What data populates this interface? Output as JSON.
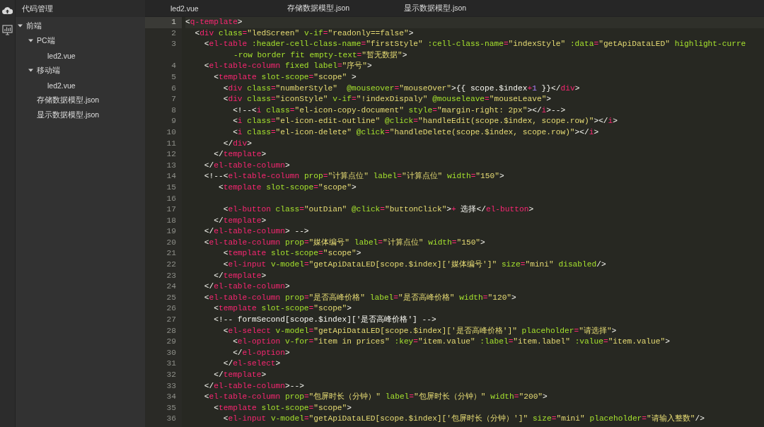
{
  "sidebar": {
    "title": "代码管理",
    "tree": [
      {
        "label": "前端",
        "expanded": true,
        "children": [
          {
            "label": "PC端",
            "expanded": true,
            "children": [
              {
                "label": "led2.vue"
              }
            ]
          },
          {
            "label": "移动端",
            "expanded": true,
            "children": [
              {
                "label": "led2.vue"
              }
            ]
          },
          {
            "label": "存储数据模型.json"
          },
          {
            "label": "显示数据模型.json"
          }
        ]
      }
    ]
  },
  "tabs": [
    {
      "label": "led2.vue"
    },
    {
      "label": "存储数据模型.json"
    },
    {
      "label": "显示数据模型.json"
    }
  ],
  "editor": {
    "lines": [
      {
        "n": "1",
        "current": true,
        "text": "<q-template>"
      },
      {
        "n": "2",
        "current": false,
        "text": "  <div class=\"ledScreen\" v-if=\"readonly==false\">"
      },
      {
        "n": "3",
        "current": false,
        "text": "    <el-table :header-cell-class-name=\"firstStyle\" :cell-class-name=\"indexStyle\" :data=\"getApiDataLED\" highlight-curre",
        "wrap": "-row border fit empty-text=\"暂无数据\">"
      },
      {
        "n": "4",
        "current": false,
        "text": "    <el-table-column fixed label=\"序号\">"
      },
      {
        "n": "5",
        "current": false,
        "text": "      <template slot-scope=\"scope\" >"
      },
      {
        "n": "6",
        "current": false,
        "text": "        <div class=\"numberStyle\"  @mouseover=\"mouseOver\">{{ scope.$index+1 }}</div>"
      },
      {
        "n": "7",
        "current": false,
        "text": "        <div class=\"iconStyle\" v-if=\"!indexDispaly\" @mouseleave=\"mouseLeave\">"
      },
      {
        "n": "8",
        "current": false,
        "text": "          <!--<i class=\"el-icon-copy-document\" style=\"margin-right: 2px\"></i>-->"
      },
      {
        "n": "9",
        "current": false,
        "text": "          <i class=\"el-icon-edit-outline\" @click=\"handleEdit(scope.$index, scope.row)\"></i>"
      },
      {
        "n": "10",
        "current": false,
        "text": "          <i class=\"el-icon-delete\" @click=\"handleDelete(scope.$index, scope.row)\"></i>"
      },
      {
        "n": "11",
        "current": false,
        "text": "        </div>"
      },
      {
        "n": "12",
        "current": false,
        "text": "      </template>"
      },
      {
        "n": "13",
        "current": false,
        "text": "    </el-table-column>"
      },
      {
        "n": "14",
        "current": false,
        "text": "    <!--<el-table-column prop=\"计算点位\" label=\"计算点位\" width=\"150\">"
      },
      {
        "n": "15",
        "current": false,
        "text": "       <template slot-scope=\"scope\">"
      },
      {
        "n": "16",
        "current": false
      },
      {
        "n": "17",
        "current": false,
        "text": "        <el-button class=\"outDian\" @click=\"buttonClick\">+ 选择</el-button>"
      },
      {
        "n": "18",
        "current": false,
        "text": "      </template>"
      },
      {
        "n": "19",
        "current": false,
        "text": "    </el-table-column> -->"
      },
      {
        "n": "20",
        "current": false,
        "text": "    <el-table-column prop=\"媒体编号\" label=\"计算点位\" width=\"150\">"
      },
      {
        "n": "21",
        "current": false,
        "text": "        <template slot-scope=\"scope\">"
      },
      {
        "n": "22",
        "current": false,
        "text": "        <el-input v-model=\"getApiDataLED[scope.$index]['媒体编号']\" size=\"mini\" disabled/>"
      },
      {
        "n": "23",
        "current": false,
        "text": "      </template>"
      },
      {
        "n": "24",
        "current": false,
        "text": "    </el-table-column>"
      },
      {
        "n": "25",
        "current": false,
        "text": "    <el-table-column prop=\"是否高峰价格\" label=\"是否高峰价格\" width=\"120\">"
      },
      {
        "n": "26",
        "current": false,
        "text": "      <template slot-scope=\"scope\">"
      },
      {
        "n": "27",
        "current": false,
        "text": "      <!-- formSecond[scope.$index]['是否高峰价格'] -->"
      },
      {
        "n": "28",
        "current": false,
        "text": "        <el-select v-model=\"getApiDataLED[scope.$index]['是否高峰价格']\" placeholder=\"请选择\">"
      },
      {
        "n": "29",
        "current": false,
        "text": "          <el-option v-for=\"item in prices\" :key=\"item.value\" :label=\"item.label\" :value=\"item.value\">"
      },
      {
        "n": "30",
        "current": false,
        "text": "          </el-option>"
      },
      {
        "n": "31",
        "current": false,
        "text": "        </el-select>"
      },
      {
        "n": "32",
        "current": false,
        "text": "      </template>"
      },
      {
        "n": "33",
        "current": false,
        "text": "    </el-table-column>-->"
      },
      {
        "n": "34",
        "current": false,
        "text": "    <el-table-column prop=\"包屏时长（分钟）\" label=\"包屏时长（分钟）\" width=\"200\">"
      },
      {
        "n": "35",
        "current": false,
        "text": "      <template slot-scope=\"scope\">"
      },
      {
        "n": "36",
        "current": false,
        "text": "        <el-input v-model=\"getApiDataLED[scope.$index]['包屏时长（分钟）']\" size=\"mini\" placeholder=\"请输入整数\"/>"
      }
    ]
  }
}
